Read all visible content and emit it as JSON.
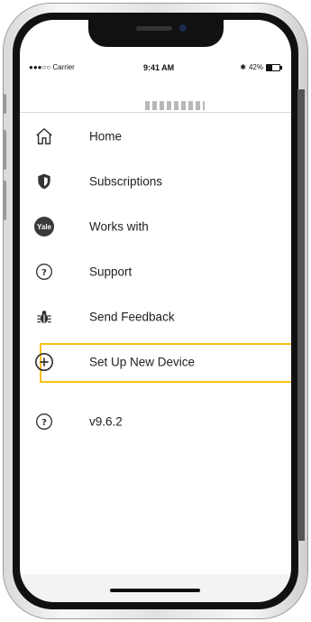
{
  "status_bar": {
    "carrier": "●●●○○ Carrier",
    "time": "9:41 AM",
    "battery": "42%"
  },
  "menu": {
    "items": [
      {
        "label": "Home",
        "icon": "home-icon"
      },
      {
        "label": "Subscriptions",
        "icon": "shield-icon"
      },
      {
        "label": "Works with",
        "icon": "yale-logo-icon",
        "badge": "Yale"
      },
      {
        "label": "Support",
        "icon": "question-circle-icon"
      },
      {
        "label": "Send Feedback",
        "icon": "bug-icon"
      },
      {
        "label": "Set Up New Device",
        "icon": "plus-circle-icon",
        "highlighted": true
      },
      {
        "label": "v9.6.2",
        "icon": "question-circle-icon"
      }
    ]
  },
  "colors": {
    "highlight": "#f5c216",
    "text": "#222222",
    "icon": "#333333"
  }
}
